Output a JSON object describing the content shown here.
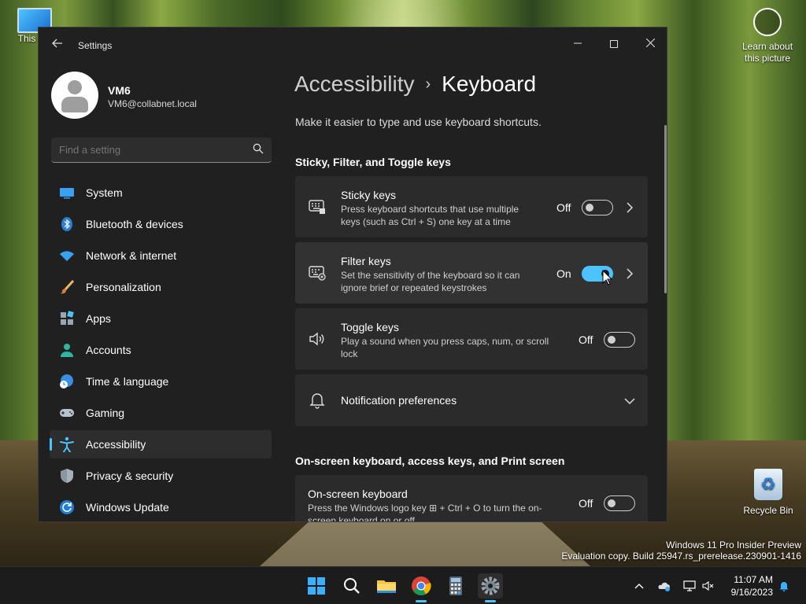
{
  "desktop": {
    "this_pc_label": "This PC",
    "recycle_label": "Recycle Bin",
    "learn_label_1": "Learn about",
    "learn_label_2": "this picture",
    "watermark_1": "Windows 11 Pro Insider Preview",
    "watermark_2": "Evaluation copy. Build 25947.rs_prerelease.230901-1416"
  },
  "window": {
    "title": "Settings",
    "back_icon": "arrow-left-icon",
    "minimize_icon": "minimize-icon",
    "maximize_icon": "maximize-icon",
    "close_icon": "close-icon"
  },
  "user": {
    "name": "VM6",
    "email": "VM6@collabnet.local"
  },
  "search": {
    "placeholder": "Find a setting"
  },
  "nav": {
    "items": [
      {
        "label": "System",
        "icon": "monitor-icon"
      },
      {
        "label": "Bluetooth & devices",
        "icon": "bluetooth-icon"
      },
      {
        "label": "Network & internet",
        "icon": "wifi-icon"
      },
      {
        "label": "Personalization",
        "icon": "brush-icon"
      },
      {
        "label": "Apps",
        "icon": "apps-icon"
      },
      {
        "label": "Accounts",
        "icon": "person-icon"
      },
      {
        "label": "Time & language",
        "icon": "globe-clock-icon"
      },
      {
        "label": "Gaming",
        "icon": "gamepad-icon"
      },
      {
        "label": "Accessibility",
        "icon": "accessibility-icon",
        "active": true
      },
      {
        "label": "Privacy & security",
        "icon": "shield-icon"
      },
      {
        "label": "Windows Update",
        "icon": "refresh-icon"
      }
    ]
  },
  "main": {
    "breadcrumb_parent": "Accessibility",
    "breadcrumb_separator": "›",
    "breadcrumb_current": "Keyboard",
    "subtitle": "Make it easier to type and use keyboard shortcuts.",
    "section1_title": "Sticky, Filter, and Toggle keys",
    "section2_title": "On-screen keyboard, access keys, and Print screen",
    "sticky": {
      "title": "Sticky keys",
      "desc_1": "Press keyboard shortcuts that use multiple",
      "desc_2": "keys (such as Ctrl + S) one key at a time",
      "state": "Off",
      "on": false
    },
    "filter": {
      "title": "Filter keys",
      "desc_1": "Set the sensitivity of the keyboard so it can",
      "desc_2": "ignore brief or repeated keystrokes",
      "state": "On",
      "on": true
    },
    "toggle": {
      "title": "Toggle keys",
      "desc_1": "Play a sound when you press caps, num, or scroll",
      "desc_2": "lock",
      "state": "Off",
      "on": false
    },
    "notification": {
      "title": "Notification preferences"
    },
    "osk": {
      "title": "On-screen keyboard",
      "desc_1": "Press the Windows logo key ⊞ + Ctrl + O to turn the on-",
      "desc_2": "screen keyboard on or off",
      "state": "Off",
      "on": false
    }
  },
  "taskbar": {
    "apps": [
      "windows-start-icon",
      "search-icon",
      "file-explorer-icon",
      "chrome-icon",
      "calculator-icon",
      "settings-gear-icon"
    ],
    "tray": [
      "chevron-up-icon",
      "onedrive-icon",
      "network-icon",
      "volume-muted-icon",
      "notification-bell-icon"
    ],
    "time": "11:07 AM",
    "date": "9/16/2023"
  },
  "colors": {
    "accent": "#4cc2ff",
    "window_bg": "#202020",
    "card_bg": "#2b2b2b",
    "taskbar_bg": "#1c1c1c"
  }
}
